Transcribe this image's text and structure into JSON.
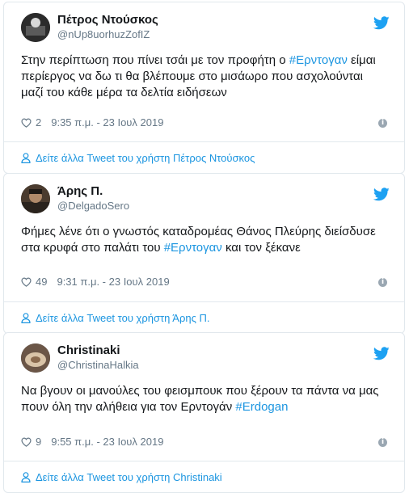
{
  "tweets": [
    {
      "name": "Πέτρος Ντούσκος",
      "handle": "@nUp8uorhuzZofIZ",
      "text_parts": [
        "Στην περίπτωση που πίνει τσάι με τον προφήτη ο ",
        "#Ερντογαν",
        " είμαι περίεργος να δω τι θα βλέπουμε  στο μισάωρο που ασχολούνται μαζί του κάθε μέρα τα δελτία ειδήσεων"
      ],
      "likes": "2",
      "timestamp": "9:35 π.μ. - 23 Ιουλ 2019",
      "footer_link": "Δείτε άλλα Tweet του χρήστη Πέτρος Ντούσκος"
    },
    {
      "name": "Άρης Π.",
      "handle": "@DelgadoSero",
      "text_parts": [
        "Φήμες λένε ότι ο γνωστός καταδρομέας Θάνος Πλεύρης διείσδυσε στα κρυφά στο παλάτι του ",
        "#Ερντογαν",
        " και τον ξέκανε"
      ],
      "likes": "49",
      "timestamp": "9:31 π.μ. - 23 Ιουλ 2019",
      "footer_link": "Δείτε άλλα Tweet του χρήστη Άρης Π."
    },
    {
      "name": "Christinaki",
      "handle": "@ChristinaHalkia",
      "text_parts": [
        "Να βγουν οι μανούλες του φεισμπουκ που ξέρουν τα πάντα να μας πουν όλη την αλήθεια για τον Ερντογάν ",
        "#Erdogan",
        ""
      ],
      "likes": "9",
      "timestamp": "9:55 π.μ. - 23 Ιουλ 2019",
      "footer_link": "Δείτε άλλα Tweet του χρήστη Christinaki"
    }
  ],
  "colors": {
    "link": "#1b95e0",
    "muted": "#657786",
    "border": "#e1e8ed"
  },
  "icons": {
    "brand": "twitter-bird-icon",
    "like": "heart-icon",
    "info": "info-icon",
    "profile": "user-icon"
  }
}
